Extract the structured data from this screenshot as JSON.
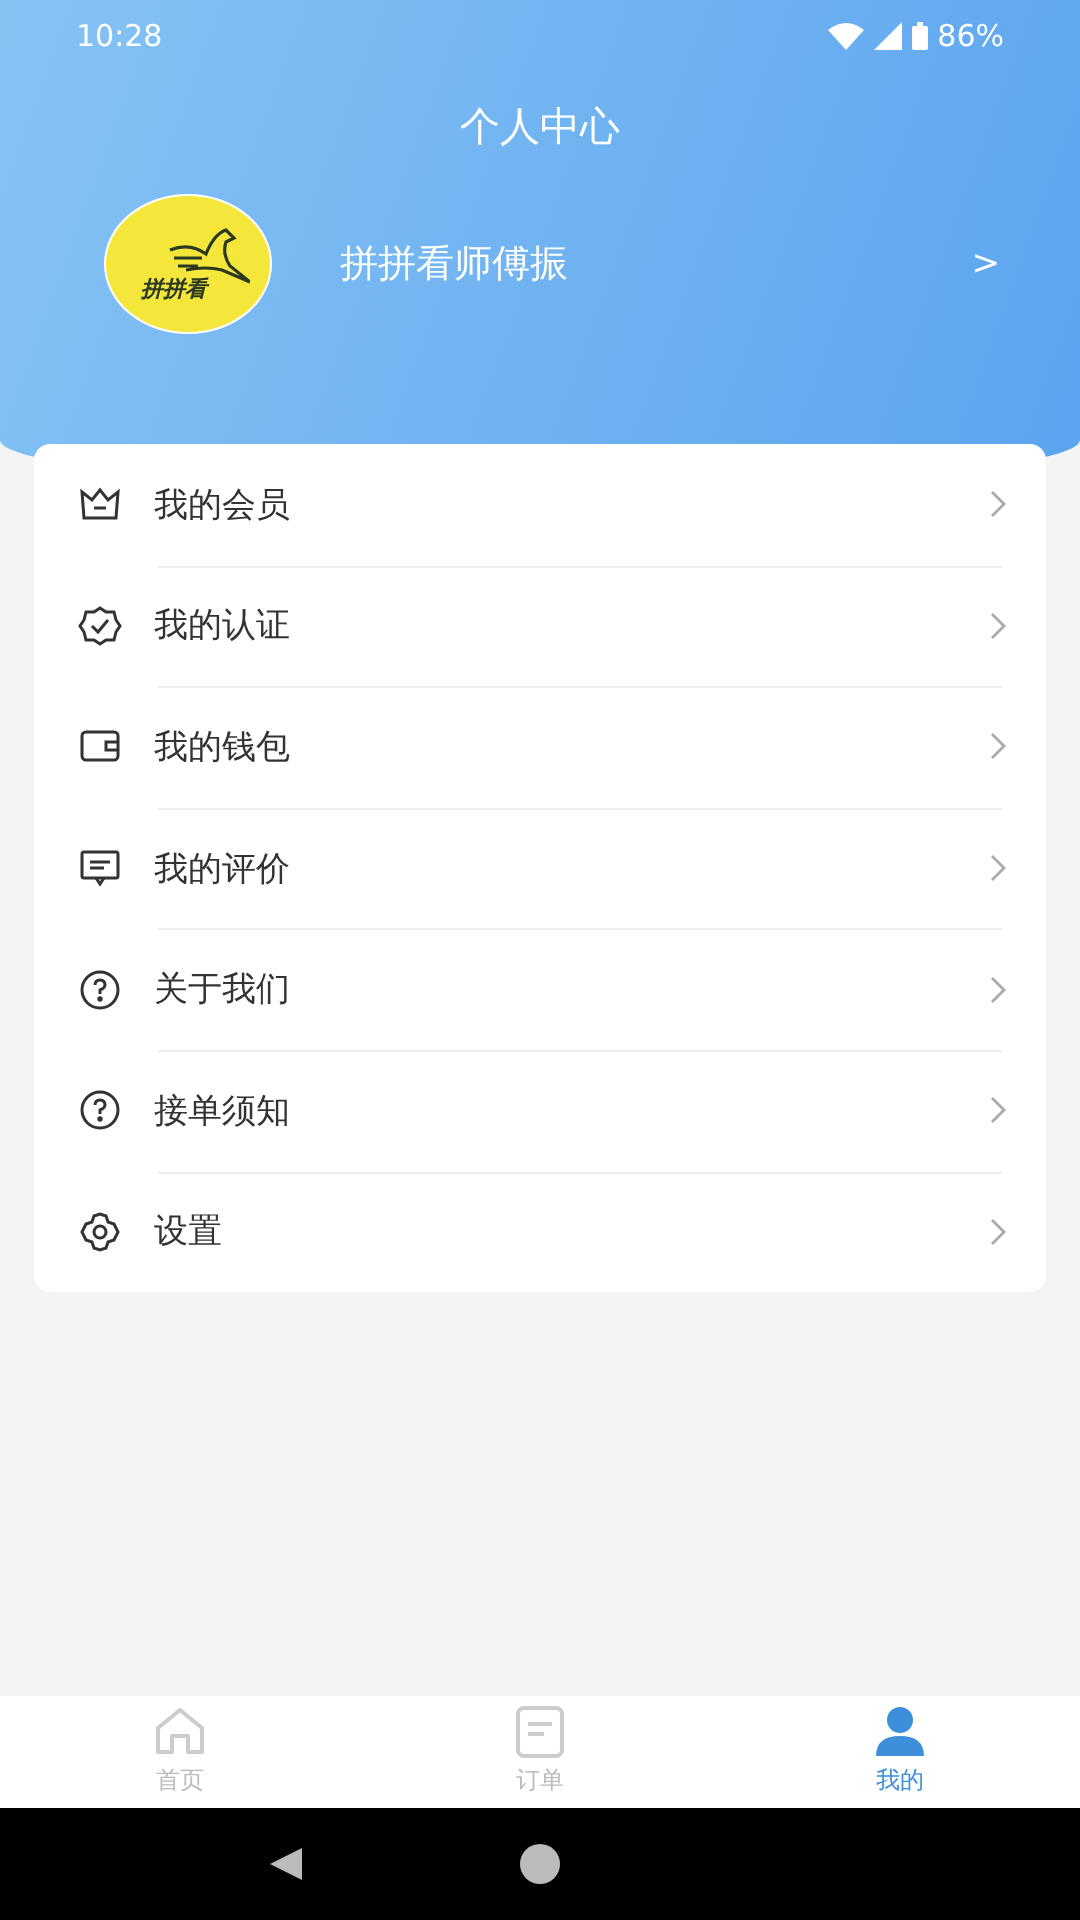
{
  "status_bar": {
    "time": "10:28",
    "battery": "86%"
  },
  "header": {
    "title": "个人中心"
  },
  "profile": {
    "avatar_text": "拼拼看",
    "name": "拼拼看师傅振",
    "chevron": ">"
  },
  "menu": [
    {
      "kind": "crown",
      "label": "我的会员"
    },
    {
      "kind": "badge",
      "label": "我的认证"
    },
    {
      "kind": "wallet",
      "label": "我的钱包"
    },
    {
      "kind": "message",
      "label": "我的评价"
    },
    {
      "kind": "question",
      "label": "关于我们"
    },
    {
      "kind": "question",
      "label": "接单须知"
    },
    {
      "kind": "gear",
      "label": "设置"
    }
  ],
  "tabs": [
    {
      "kind": "home",
      "label": "首页",
      "selected": false
    },
    {
      "kind": "list",
      "label": "订单",
      "selected": false
    },
    {
      "kind": "person",
      "label": "我的",
      "selected": true
    }
  ]
}
